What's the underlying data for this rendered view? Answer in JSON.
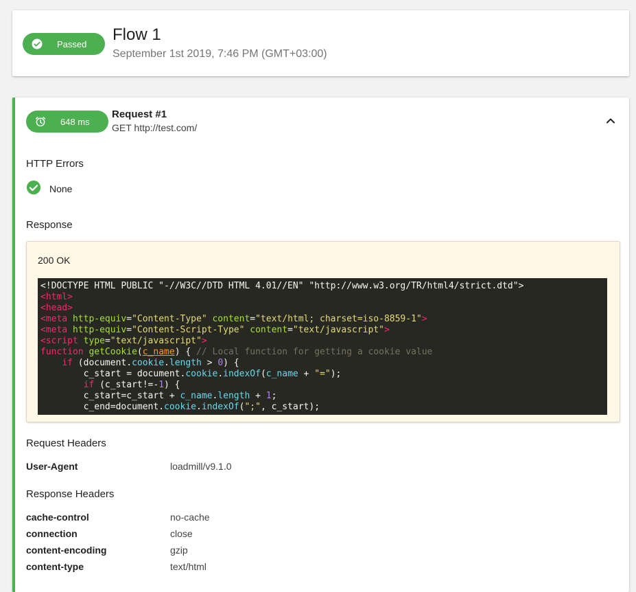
{
  "flow": {
    "status_label": "Passed",
    "title": "Flow 1",
    "date": "September 1st 2019, 7:46 PM (GMT+03:00)"
  },
  "request": {
    "duration_label": "648 ms",
    "title": "Request #1",
    "url": "GET http://test.com/",
    "http_errors_title": "HTTP Errors",
    "http_errors_value": "None",
    "response_title": "Response",
    "status_text": "200 OK",
    "request_headers_title": "Request Headers",
    "request_headers": [
      {
        "key": "User-Agent",
        "value": "loadmill/v9.1.0"
      }
    ],
    "response_headers_title": "Response Headers",
    "response_headers": [
      {
        "key": "cache-control",
        "value": "no-cache"
      },
      {
        "key": "connection",
        "value": "close"
      },
      {
        "key": "content-encoding",
        "value": "gzip"
      },
      {
        "key": "content-type",
        "value": "text/html"
      }
    ]
  },
  "code": {
    "l1": "<!DOCTYPE HTML PUBLIC \"-//W3C//DTD HTML 4.01//EN\" \"http://www.w3.org/TR/html4/strict.dtd\">",
    "l2_tag": "<html>",
    "l3_tag": "<head>",
    "l4_open": "<meta ",
    "l4_a1": "http-equiv",
    "l4_v1": "\"Content-Type\"",
    "l4_a2": "content",
    "l4_v2": "\"text/html; charset=iso-8859-1\"",
    "l4_close": ">",
    "l5_open": "<meta ",
    "l5_a1": "http-equiv",
    "l5_v1": "\"Content-Script-Type\"",
    "l5_a2": "content",
    "l5_v2": "\"text/javascript\"",
    "l5_close": ">",
    "l6_open": "<script ",
    "l6_a1": "type",
    "l6_v1": "\"text/javascript\"",
    "l6_close": ">",
    "l7_kw": "function",
    "l7_fn": "getCookie",
    "l7_arg": "c_name",
    "l7_cmt": "// Local function for getting a cookie value",
    "l8_kw": "if",
    "l8_obj": "document",
    "l8_p1": "cookie",
    "l8_p2": "length",
    "l8_num": "0",
    "l9_var": "c_start = document.",
    "l9_p1": "cookie",
    "l9_p2": "indexOf",
    "l9_arg": "c_name",
    "l9_str": "\"=\"",
    "l10_kw": "if",
    "l10_rest": "(c_start!=-",
    "l10_num": "1",
    "l11_var": "c_start=c_start + ",
    "l11_p1": "c_name",
    "l11_p2": "length",
    "l11_num": "1",
    "l12_var": "c_end=document.",
    "l12_p1": "cookie",
    "l12_p2": "indexOf",
    "l12_str": "\";\"",
    "l12_rest": ", c_start);"
  },
  "colors": {
    "success": "#4caf50",
    "code_bg": "#272822",
    "response_bg": "#fff8e7"
  },
  "icons": {
    "passed": "check-circle-icon",
    "duration": "alarm-clock-icon",
    "collapse": "chevron-up-icon",
    "none": "check-circle-icon"
  }
}
